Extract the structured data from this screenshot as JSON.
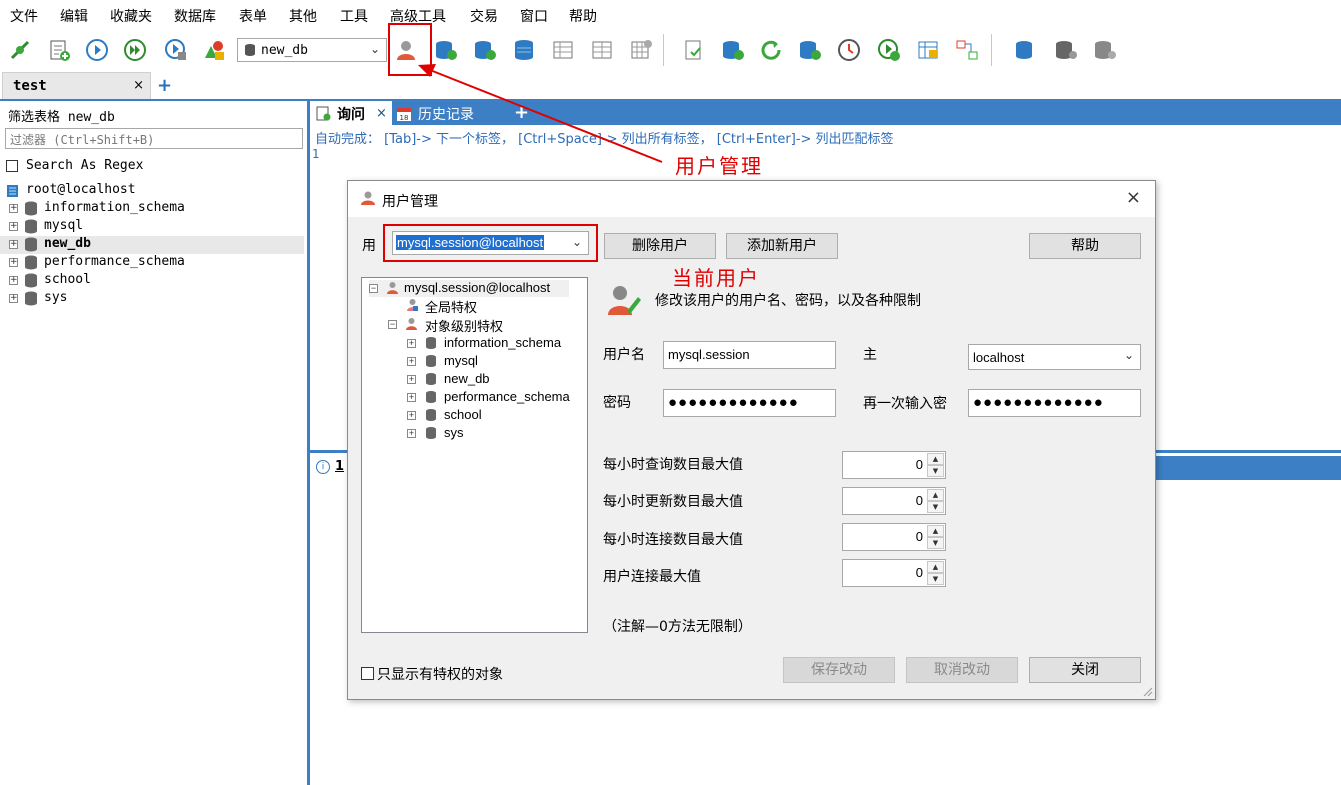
{
  "menu": [
    "文件",
    "编辑",
    "收藏夹",
    "数据库",
    "表单",
    "其他",
    "工具",
    "高级工具",
    "交易",
    "窗口",
    "帮助"
  ],
  "toolbar": {
    "db_selected": "new_db"
  },
  "connection_tab": {
    "label": "test",
    "close": "×",
    "add": "+"
  },
  "left_panel": {
    "filter_title": "筛选表格 new_db",
    "filter_placeholder": "过滤器 (Ctrl+Shift+B)",
    "regex_label": "Search As Regex",
    "host": "root@localhost",
    "databases": [
      "information_schema",
      "mysql",
      "new_db",
      "performance_schema",
      "school",
      "sys"
    ],
    "selected_db": "new_db"
  },
  "query": {
    "tab_query": "询问",
    "tab_history": "历史记录",
    "tab_close": "×",
    "tab_add": "+",
    "autocomplete": "自动完成： [Tab]-> 下一个标签， [Ctrl+Space]-> 列出所有标签， [Ctrl+Enter]-> 列出匹配标签",
    "line_number": "1",
    "result_tab": "1"
  },
  "annotations": {
    "user_mgmt": "用户管理",
    "current_user": "当前用户"
  },
  "dialog": {
    "title": "用户管理",
    "close": "×",
    "user_label": "用",
    "user_value": "mysql.session@localhost",
    "delete_user": "删除用户",
    "add_user": "添加新用户",
    "help": "帮助",
    "tree": {
      "root": "mysql.session@localhost",
      "global": "全局特权",
      "object_level": "对象级别特权",
      "dbs": [
        "information_schema",
        "mysql",
        "new_db",
        "performance_schema",
        "school",
        "sys"
      ]
    },
    "description": "修改该用户的用户名、密码，以及各种限制",
    "username_label": "用户名",
    "username_value": "mysql.session",
    "host_label": "主",
    "host_value": "localhost",
    "password_label": "密码",
    "password_value": "●●●●●●●●●●●●●",
    "confirm_label": "再一次输入密",
    "confirm_value": "●●●●●●●●●●●●●",
    "limits": [
      {
        "label": "每小时查询数目最大值",
        "value": "0"
      },
      {
        "label": "每小时更新数目最大值",
        "value": "0"
      },
      {
        "label": "每小时连接数目最大值",
        "value": "0"
      },
      {
        "label": "用户连接最大值",
        "value": "0"
      }
    ],
    "note": "（注解—0方法无限制）",
    "only_privileged": "只显示有特权的对象",
    "save": "保存改动",
    "cancel": "取消改动",
    "close_btn": "关闭"
  },
  "colors": {
    "accent": "#3c7fc4",
    "annotation": "#e00000",
    "dialog_bg": "#f0f0f0"
  }
}
